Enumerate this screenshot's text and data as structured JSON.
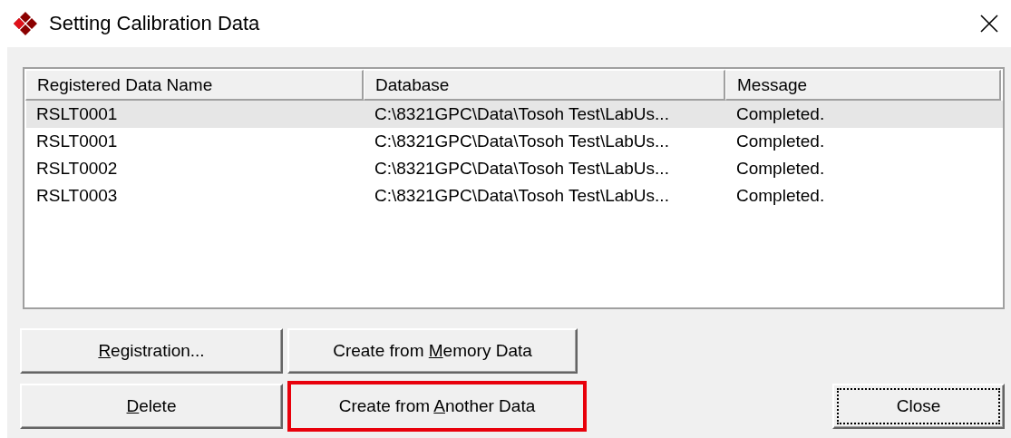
{
  "window": {
    "title": "Setting Calibration Data"
  },
  "table": {
    "columns": [
      "Registered Data Name",
      "Database",
      "Message"
    ],
    "rows": [
      {
        "cells": [
          "RSLT0001",
          "C:\\8321GPC\\Data\\Tosoh Test\\LabUs...",
          "Completed."
        ],
        "selected": true
      },
      {
        "cells": [
          "RSLT0001",
          "C:\\8321GPC\\Data\\Tosoh Test\\LabUs...",
          "Completed."
        ],
        "selected": false
      },
      {
        "cells": [
          "RSLT0002",
          "C:\\8321GPC\\Data\\Tosoh Test\\LabUs...",
          "Completed."
        ],
        "selected": false
      },
      {
        "cells": [
          "RSLT0003",
          "C:\\8321GPC\\Data\\Tosoh Test\\LabUs...",
          "Completed."
        ],
        "selected": false
      }
    ]
  },
  "top_buttons": [
    {
      "key": "R",
      "post": "egistration...",
      "highlighted": false,
      "focused": false
    },
    {
      "pre": "Create from ",
      "key": "M",
      "post": "emory Data",
      "highlighted": false,
      "focused": false
    }
  ],
  "bottom_buttons": [
    {
      "key": "D",
      "post": "elete",
      "highlighted": false,
      "focused": false
    },
    {
      "pre": "Create from ",
      "key": "A",
      "post": "nother Data",
      "highlighted": true,
      "focused": false
    },
    {
      "pre": "Close",
      "highlighted": false,
      "focused": true
    }
  ]
}
